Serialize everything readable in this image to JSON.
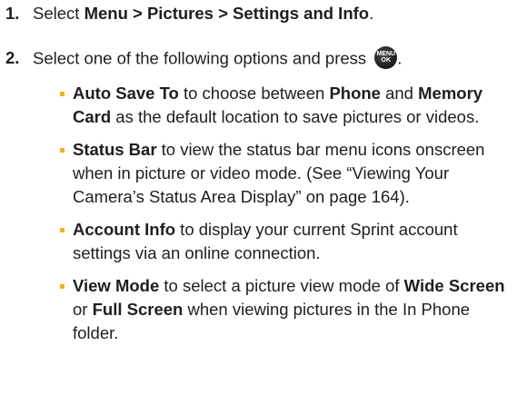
{
  "steps": [
    {
      "number": "1.",
      "text_1": "Select ",
      "bold_1": "Menu > Pictures > Settings and Info",
      "text_2": "."
    },
    {
      "number": "2.",
      "text_1": "Select one of the following options and press",
      "key_top": "MENU",
      "key_bottom": "OK",
      "text_2": "."
    }
  ],
  "options": [
    {
      "title": "Auto Save To",
      "t1": " to choose between ",
      "b1": "Phone",
      "t2": " and ",
      "b2": "Memory Card",
      "t3": " as the default location to save pictures or videos."
    },
    {
      "title": "Status Bar",
      "t1": " to view the status bar menu icons onscreen when in picture or video mode. (See “Viewing Your Camera’s Status Area Display” on page 164)."
    },
    {
      "title": "Account Info",
      "t1": " to display your current Sprint account settings via an online connection."
    },
    {
      "title": "View Mode",
      "t1": " to select a picture view mode of ",
      "b1": "Wide Screen",
      "t2": " or ",
      "b2": "Full Screen",
      "t3": " when viewing pictures in the In Phone folder."
    }
  ],
  "colors": {
    "bullet": "#f0b323",
    "text": "#1e1e1e",
    "key": "#1a1a1a"
  },
  "icons": {
    "menu_key": "menu-ok-key-icon",
    "bullet": "square-bullet-icon"
  }
}
